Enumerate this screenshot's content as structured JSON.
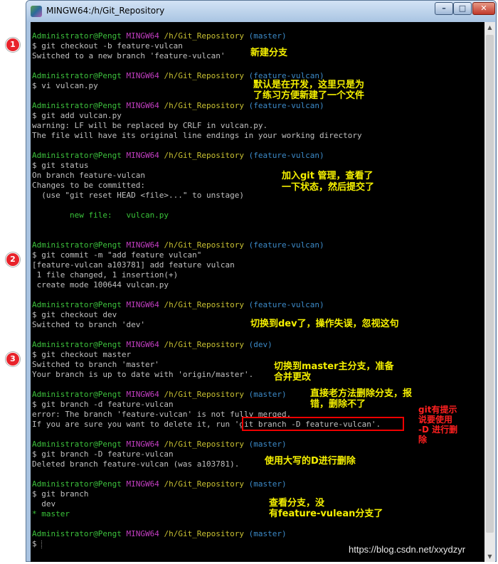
{
  "window": {
    "title": "MINGW64:/h/Git_Repository",
    "buttons": {
      "minimize": "–",
      "maximize": "□",
      "close": "✕"
    }
  },
  "colors": {
    "user": "#3cc03c",
    "mingw": "#c33ec2",
    "path": "#c8c032",
    "branch": "#3c8ac8",
    "annotation": "#f5f000",
    "box": "#ff0000"
  },
  "step_markers": [
    "1",
    "2",
    "3"
  ],
  "terminal": {
    "prompt_user": "Administrator@Pengt",
    "prompt_env": "MINGW64",
    "prompt_path": "/h/Git_Repository",
    "b_master": "(master)",
    "b_feature": "(feature-vulcan)",
    "b_dev": "(dev)",
    "cmd_checkout_b": "$ git checkout -b feature-vulcan",
    "out_switched_new": "Switched to a new branch 'feature-vulcan'",
    "cmd_vi": "$ vi vulcan.py",
    "cmd_add": "$ git add vulcan.py",
    "out_warning": "warning: LF will be replaced by CRLF in vulcan.py.",
    "out_line_endings": "The file will have its original line endings in your working directory",
    "cmd_status": "$ git status",
    "out_on_branch": "On branch feature-vulcan",
    "out_changes": "Changes to be committed:",
    "out_use_reset": "  (use \"git reset HEAD <file>...\" to unstage)",
    "out_new_file": "        new file:   vulcan.py",
    "cmd_commit": "$ git commit -m \"add feature vulcan\"",
    "out_commit_hash": "[feature-vulcan a103781] add feature vulcan",
    "out_files_changed": " 1 file changed, 1 insertion(+)",
    "out_create_mode": " create mode 100644 vulcan.py",
    "cmd_checkout_dev": "$ git checkout dev",
    "out_switched_dev": "Switched to branch 'dev'",
    "cmd_checkout_master": "$ git checkout master",
    "out_switched_master": "Switched to branch 'master'",
    "out_up_to_date": "Your branch is up to date with 'origin/master'.",
    "cmd_branch_d": "$ git branch -d feature-vulcan",
    "out_not_merged": "error: The branch 'feature-vulcan' is not fully merged.",
    "out_if_sure": "If you are sure you want to delete it, run 'git branch -D feature-vulcan'.",
    "cmd_branch_D": "$ git branch -D feature-vulcan",
    "out_deleted": "Deleted branch feature-vulcan (was a103781).",
    "cmd_branch": "$ git branch",
    "out_dev": "  dev",
    "out_master": "* master",
    "cmd_empty": "$"
  },
  "annotations": {
    "a1": "新建分支",
    "a2_l1": "默认是在开发，这里只是为",
    "a2_l2": "了练习方便新建了一个文件",
    "a3_l1": "加入git 管理，查看了",
    "a3_l2": "一下状态，然后提交了",
    "a4": "切换到dev了，操作失误，忽视这句",
    "a5_l1": "切换到master主分支，准备",
    "a5_l2": "合并更改",
    "a6_l1": "直接老方法删除分支，报",
    "a6_l2": "错，删除不了",
    "a7_l1": "git有提示",
    "a7_l2": "说要使用",
    "a7_l3": "-D 进行删",
    "a7_l4": "除",
    "a8": "使用大写的D进行删除",
    "a9_l1": "查看分支，没",
    "a9_l2": "有feature-vulean分支了"
  },
  "watermark": "https://blog.csdn.net/xxydzyr"
}
